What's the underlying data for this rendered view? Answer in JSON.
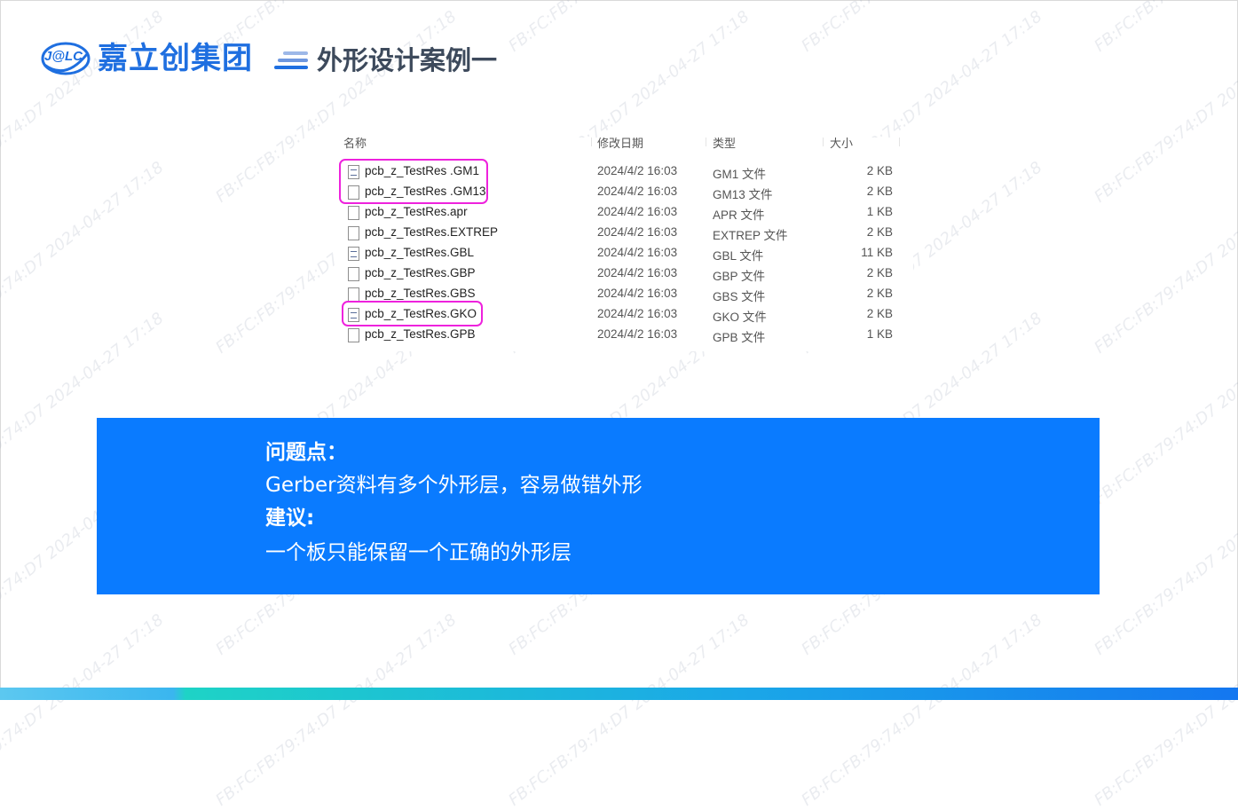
{
  "header": {
    "logo_text": "J@LC",
    "brand": "嘉立创集团",
    "title": "外形设计案例一"
  },
  "explorer": {
    "columns": [
      "名称",
      "修改日期",
      "类型",
      "大小"
    ],
    "rows": [
      {
        "name": "pcb_z_TestRes .GM1",
        "date": "2024/4/2 16:03",
        "type": "GM1 文件",
        "size": "2 KB",
        "icon": "document-icon"
      },
      {
        "name": "pcb_z_TestRes .GM13",
        "date": "2024/4/2 16:03",
        "type": "GM13 文件",
        "size": "2 KB",
        "icon": "file-icon"
      },
      {
        "name": "pcb_z_TestRes.apr",
        "date": "2024/4/2 16:03",
        "type": "APR 文件",
        "size": "1 KB",
        "icon": "file-icon"
      },
      {
        "name": "pcb_z_TestRes.EXTREP",
        "date": "2024/4/2 16:03",
        "type": "EXTREP 文件",
        "size": "2 KB",
        "icon": "file-icon"
      },
      {
        "name": "pcb_z_TestRes.GBL",
        "date": "2024/4/2 16:03",
        "type": "GBL 文件",
        "size": "11 KB",
        "icon": "document-icon"
      },
      {
        "name": "pcb_z_TestRes.GBP",
        "date": "2024/4/2 16:03",
        "type": "GBP 文件",
        "size": "2 KB",
        "icon": "file-icon"
      },
      {
        "name": "pcb_z_TestRes.GBS",
        "date": "2024/4/2 16:03",
        "type": "GBS 文件",
        "size": "2 KB",
        "icon": "file-icon"
      },
      {
        "name": "pcb_z_TestRes.GKO",
        "date": "2024/4/2 16:03",
        "type": "GKO 文件",
        "size": "2 KB",
        "icon": "document-icon"
      },
      {
        "name": "pcb_z_TestRes.GPB",
        "date": "2024/4/2 16:03",
        "type": "GPB 文件",
        "size": "1 KB",
        "icon": "file-icon"
      }
    ]
  },
  "info": {
    "problem_heading": "问题点：",
    "problem_text": "Gerber资料有多个外形层，容易做错外形",
    "advice_heading": "建议:",
    "advice_text": "一个板只能保留一个正确的外形层"
  },
  "watermark": "FB:FC:FB:79:74:D7  2024-04-27  17:18",
  "colors": {
    "brand_blue": "#1f6fe0",
    "info_bg": "#0a7bff",
    "highlight": "#ee22dd"
  }
}
